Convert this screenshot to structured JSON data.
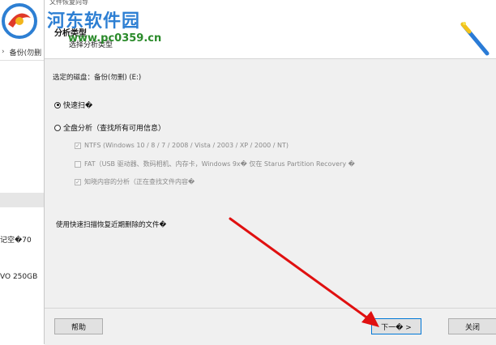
{
  "background_window": {
    "toolbar_label": "备份(勿删",
    "chevron": "›",
    "text_line1": "记空�70",
    "text_line2": "VO 250GB"
  },
  "dialog": {
    "titlebar_text": "文件恢复向导",
    "header_title": "分析类型",
    "header_subtitle": "选择分析类型",
    "selected_disk": "选定的磁盘：备份(勿删) (E:)",
    "options": {
      "quick_scan": "快速扫�",
      "full_analysis": "全盘分析（查找所有可用信息）"
    },
    "checkboxes": {
      "ntfs": "NTFS (Windows 10 / 8 / 7 / 2008 / Vista / 2003 / XP / 2000 / NT)",
      "fat": "FAT（USB 驱动器、数码相机、内存卡，Windows 9x�  仅在 Starus Partition Recovery �",
      "content_aware": "知晓内容的分析（正在查找文件内容�"
    },
    "hint": "使用快速扫描恢复近期删除的文件�",
    "buttons": {
      "help": "帮助",
      "next": "下一� >",
      "close": "关闭"
    }
  },
  "watermark": {
    "title": "河东软件园",
    "url": "www.pc0359.cn"
  },
  "colors": {
    "accent": "#0078d7",
    "arrow": "#e01010",
    "watermark_blue": "#2d7fd3",
    "watermark_green": "#2a8a2a"
  }
}
